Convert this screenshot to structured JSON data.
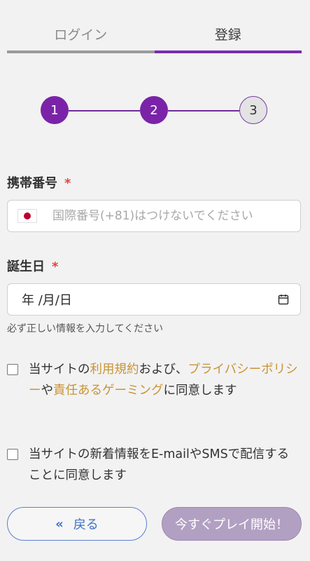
{
  "tabs": {
    "login": "ログイン",
    "register": "登録"
  },
  "stepper": {
    "steps": [
      "1",
      "2",
      "3"
    ],
    "current": 2
  },
  "phone": {
    "label": "携帯番号",
    "required_mark": "*",
    "placeholder": "国際番号(+81)はつけないでください",
    "flag": "japan-flag-icon"
  },
  "birthdate": {
    "label": "誕生日",
    "required_mark": "*",
    "value": "年 /月/日",
    "hint": "必ず正しい情報を入力してください"
  },
  "terms": {
    "part1": "当サイトの",
    "link_terms": "利用規約",
    "part2": "および、",
    "link_privacy": "プライバシーポリシー",
    "part3": "や",
    "link_gaming": "責任あるゲーミング",
    "part4": "に同意します"
  },
  "newsletter": {
    "text": "当サイトの新着情報をE-mailやSMSで配信することに同意します"
  },
  "buttons": {
    "back_chevron": "«",
    "back": "戻る",
    "play": "今すぐプレイ開始！"
  },
  "colors": {
    "accent": "#7a23a8",
    "link": "#c99436",
    "back": "#3f6fc7",
    "required": "#e04444"
  }
}
